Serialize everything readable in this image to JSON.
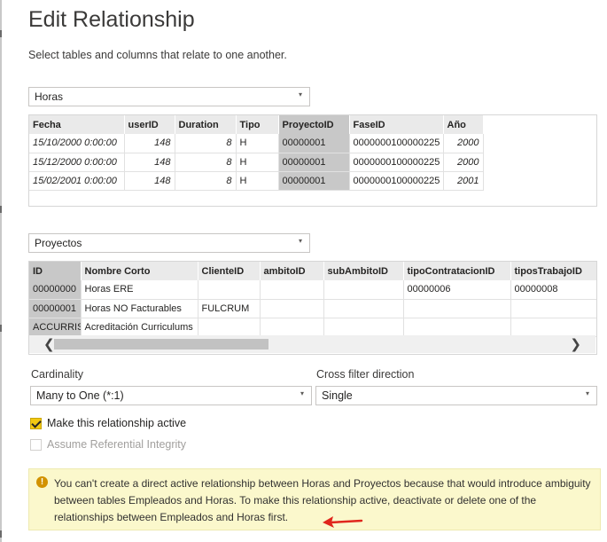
{
  "dialog": {
    "title": "Edit Relationship",
    "subtitle": "Select tables and columns that relate to one another."
  },
  "table1": {
    "selected": "Horas",
    "headers": [
      "Fecha",
      "userID",
      "Duration",
      "Tipo",
      "ProyectoID",
      "FaseID",
      "Año"
    ],
    "selected_column": "ProyectoID",
    "rows": [
      [
        "15/10/2000 0:00:00",
        "148",
        "8",
        "H",
        "00000001",
        "0000000100000225",
        "2000"
      ],
      [
        "15/12/2000 0:00:00",
        "148",
        "8",
        "H",
        "00000001",
        "0000000100000225",
        "2000"
      ],
      [
        "15/02/2001 0:00:00",
        "148",
        "8",
        "H",
        "00000001",
        "0000000100000225",
        "2001"
      ]
    ]
  },
  "table2": {
    "selected": "Proyectos",
    "headers": [
      "ID",
      "Nombre Corto",
      "ClienteID",
      "ambitoID",
      "subAmbitoID",
      "tipoContratacionID",
      "tiposTrabajoID"
    ],
    "selected_column": "ID",
    "rows": [
      [
        "00000000",
        "Horas ERE",
        "",
        "",
        "",
        "00000006",
        "00000008"
      ],
      [
        "00000001",
        "Horas NO Facturables",
        "FULCRUM",
        "",
        "",
        "",
        ""
      ],
      [
        "ACCURRIS",
        "Acreditación Curriculums",
        "",
        "",
        "",
        "",
        ""
      ]
    ]
  },
  "cardinality": {
    "label": "Cardinality",
    "value": "Many to One (*:1)"
  },
  "cross_filter": {
    "label": "Cross filter direction",
    "value": "Single"
  },
  "options": {
    "active_label": "Make this relationship active",
    "active_checked": true,
    "integrity_label": "Assume Referential Integrity",
    "integrity_checked": false
  },
  "warning": {
    "icon": "!",
    "text": "You can't create a direct active relationship between Horas and Proyectos because that would introduce ambiguity between tables Empleados and Horas. To make this relationship active, deactivate or delete one of the relationships between Empleados and Horas first."
  },
  "icons": {
    "caret": "▾",
    "scroll_left": "❮",
    "scroll_right": "❯"
  },
  "colors": {
    "selected_column": "#c8c8c8",
    "checkbox": "#f2c811",
    "warning_bg": "#fbf8cc",
    "arrow": "#e0261c"
  }
}
